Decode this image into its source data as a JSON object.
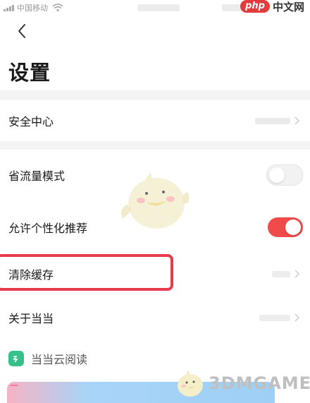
{
  "status_bar": {
    "carrier": "中国移动"
  },
  "watermark_top": {
    "php": "php",
    "text": "中文网"
  },
  "header": {
    "title": "设置"
  },
  "security": {
    "label": "安全中心"
  },
  "data_saver": {
    "label": "省流量模式",
    "enabled": false
  },
  "personalized": {
    "label": "允许个性化推荐",
    "enabled": true
  },
  "clear_cache": {
    "label": "清除缓存"
  },
  "about": {
    "label": "关于当当"
  },
  "cloud_reading": {
    "label": "当当云阅读"
  },
  "watermark_bottom": {
    "text": "3DMGAME"
  },
  "colors": {
    "accent": "#f04a4a",
    "highlight": "#e83a4d",
    "cloud_icon": "#36c08a"
  },
  "icons": {
    "back": "chevron-left",
    "chevron": "chevron-right",
    "wifi": "wifi",
    "cloud": "cloud-reading-logo"
  }
}
